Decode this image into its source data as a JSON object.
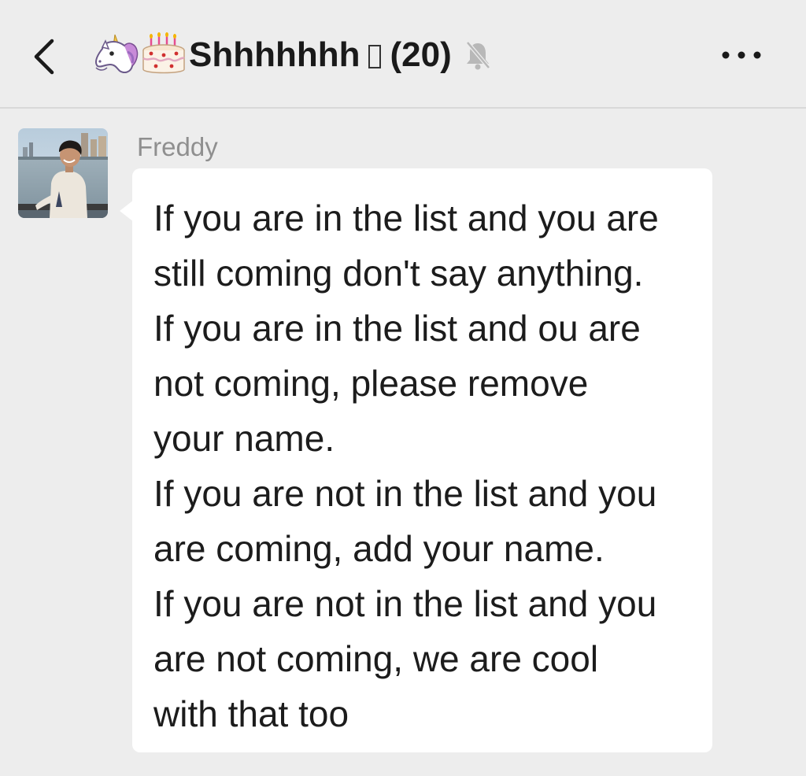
{
  "header": {
    "back_icon": "chevron-left-icon",
    "emojis": [
      "unicorn-emoji",
      "birthday-cake-emoji"
    ],
    "title": "Shhhhhhh",
    "count": "(20)",
    "mute_icon": "muted-bell-icon",
    "more_icon": "more-dots-icon"
  },
  "message": {
    "sender": "Freddy",
    "lines": [
      "If you are in the list and you are",
      "still coming don't say anything.",
      "If you are in the list and ou are",
      "not coming, please remove",
      "your name.",
      "If you are not in the list and you",
      "are coming, add your name.",
      "If you are not in the list and you",
      "are not coming, we are cool",
      "with that too"
    ]
  },
  "colors": {
    "background": "#ededed",
    "bubble": "#ffffff",
    "text": "#1c1c1c",
    "sender_name": "#8f8f8f"
  }
}
